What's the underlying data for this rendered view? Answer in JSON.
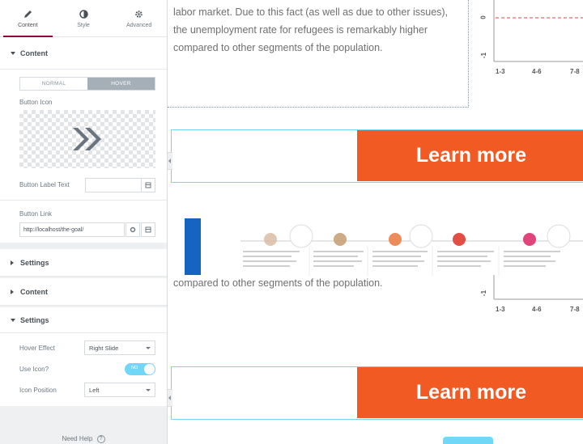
{
  "tabs": [
    {
      "label": "Content",
      "icon": "pencil-icon"
    },
    {
      "label": "Style",
      "icon": "contrast-icon"
    },
    {
      "label": "Advanced",
      "icon": "gear-icon"
    }
  ],
  "content_section": {
    "title": "Content",
    "state_normal": "NORMAL",
    "state_hover": "HOVER",
    "icon_label": "Button Icon",
    "label_text_label": "Button Label Text",
    "label_text_value": "",
    "link_label": "Button Link",
    "link_value": "http://localhost/the-goal/"
  },
  "collapsed": {
    "settings1": "Settings",
    "content2": "Content"
  },
  "settings_section": {
    "title": "Settings",
    "hover_effect_label": "Hover Effect",
    "hover_effect_value": "Right Slide",
    "use_icon_label": "Use Icon?",
    "use_icon_toggle": "NO",
    "icon_position_label": "Icon Position",
    "icon_position_value": "Left"
  },
  "footer": {
    "help": "Need Help"
  },
  "main": {
    "para_top_lines": [
      "labor market. Due to this fact (as well as due to other issues),",
      "the unemployment rate for refugees is remarkably higher",
      "compared to other segments of the population."
    ],
    "para_mid": "compared to other segments of the population.",
    "learn_more": "Learn more",
    "chart_ticks": [
      "1-3",
      "4-6",
      "7-8"
    ],
    "chart_y_tick_top": "0",
    "chart_y_tick_bottom": "-1"
  },
  "colors": {
    "accent": "#93003c",
    "button_orange": "#f15a22",
    "toggle_blue": "#71d7f7"
  }
}
